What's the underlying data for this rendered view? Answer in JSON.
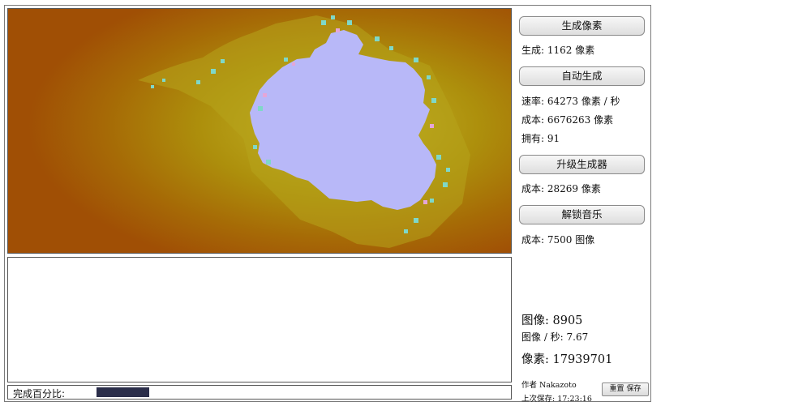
{
  "controls": {
    "generate_button": "生成像素",
    "generate_line": "生成: 1162 像素",
    "auto_button": "自动生成",
    "rate_line": "速率: 64273 像素 / 秒",
    "auto_cost_line": "成本: 6676263 像素",
    "owned_line": "拥有: 91",
    "upgrade_button": "升级生成器",
    "upgrade_cost_line": "成本: 28269 像素",
    "music_button": "解锁音乐",
    "music_cost_line": "成本: 7500 图像"
  },
  "stats": {
    "images_line": "图像: 8905",
    "images_rate_line": "图像 / 秒: 7.67",
    "pixels_line": "像素: 17939701"
  },
  "footer": {
    "author": "作者 Nakazoto",
    "last_saved": "上次保存: 17:23:16",
    "reset_label": "重置",
    "save_label": "保存"
  },
  "progress": {
    "label": "完成百分比:",
    "fraction": 0.13,
    "color": "#2b2e4a"
  },
  "colors": {
    "fractal_outer": "#a04f05",
    "fractal_mid": "#a47d07",
    "fractal_inner": "#b8ab20",
    "fractal_set": "#b8b8f8",
    "fractal_edge": "#7fd8c8"
  }
}
